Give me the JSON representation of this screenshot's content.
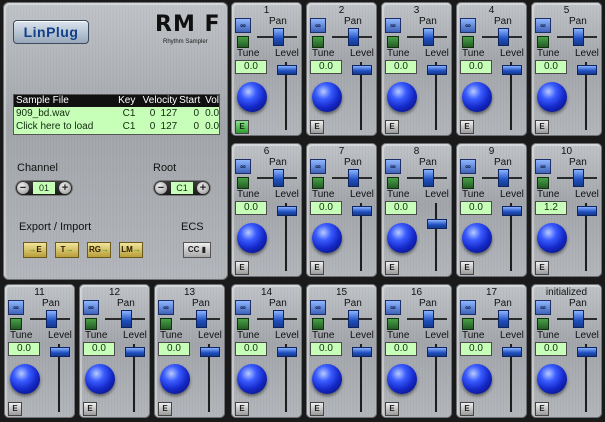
{
  "app": {
    "logo_text": "LinPlug",
    "product_name": "RM F",
    "product_subtitle": "Rhythm Sampler"
  },
  "sample_table": {
    "headers": [
      "Sample File",
      "Key",
      "Velocity",
      "Start",
      "Vol"
    ],
    "rows": [
      [
        "909_bd.wav",
        "C1",
        "0",
        "127",
        "0",
        "0.0"
      ],
      [
        "Click here to load",
        "C1",
        "0",
        "127",
        "0",
        "0.0"
      ]
    ]
  },
  "channel": {
    "label": "Channel",
    "value": "01"
  },
  "root": {
    "label": "Root",
    "value": "C1"
  },
  "export": {
    "label": "Export / Import",
    "buttons": [
      "E",
      "T",
      "RG",
      "LM"
    ]
  },
  "ecs": {
    "label": "ECS",
    "button": "CC"
  },
  "strip_labels": {
    "pan": "Pan",
    "tune": "Tune",
    "level": "Level",
    "loop": "∞",
    "e": "E"
  },
  "channels": [
    {
      "number": "1",
      "tune": "0.0",
      "pan": 0.5,
      "level": 0.05,
      "e_active": true
    },
    {
      "number": "2",
      "tune": "0.0",
      "pan": 0.5,
      "level": 0.05,
      "e_active": false
    },
    {
      "number": "3",
      "tune": "0.0",
      "pan": 0.5,
      "level": 0.05,
      "e_active": false
    },
    {
      "number": "4",
      "tune": "0.0",
      "pan": 0.5,
      "level": 0.05,
      "e_active": false
    },
    {
      "number": "5",
      "tune": "0.0",
      "pan": 0.5,
      "level": 0.05,
      "e_active": false
    },
    {
      "number": "6",
      "tune": "0.0",
      "pan": 0.5,
      "level": 0.05,
      "e_active": false
    },
    {
      "number": "7",
      "tune": "0.0",
      "pan": 0.5,
      "level": 0.05,
      "e_active": false
    },
    {
      "number": "8",
      "tune": "0.0",
      "pan": 0.5,
      "level": 0.25,
      "e_active": false
    },
    {
      "number": "9",
      "tune": "0.0",
      "pan": 0.5,
      "level": 0.05,
      "e_active": false
    },
    {
      "number": "10",
      "tune": "1.2",
      "pan": 0.5,
      "level": 0.05,
      "e_active": false
    },
    {
      "number": "11",
      "tune": "0.0",
      "pan": 0.5,
      "level": 0.05,
      "e_active": false
    },
    {
      "number": "12",
      "tune": "0.0",
      "pan": 0.5,
      "level": 0.05,
      "e_active": false
    },
    {
      "number": "13",
      "tune": "0.0",
      "pan": 0.5,
      "level": 0.05,
      "e_active": false
    },
    {
      "number": "14",
      "tune": "0.0",
      "pan": 0.5,
      "level": 0.05,
      "e_active": false
    },
    {
      "number": "15",
      "tune": "0.0",
      "pan": 0.5,
      "level": 0.05,
      "e_active": false
    },
    {
      "number": "16",
      "tune": "0.0",
      "pan": 0.5,
      "level": 0.05,
      "e_active": false
    },
    {
      "number": "17",
      "tune": "0.0",
      "pan": 0.5,
      "level": 0.05,
      "e_active": false
    },
    {
      "number": "initialized",
      "tune": "0.0",
      "pan": 0.5,
      "level": 0.05,
      "e_active": false
    }
  ]
}
